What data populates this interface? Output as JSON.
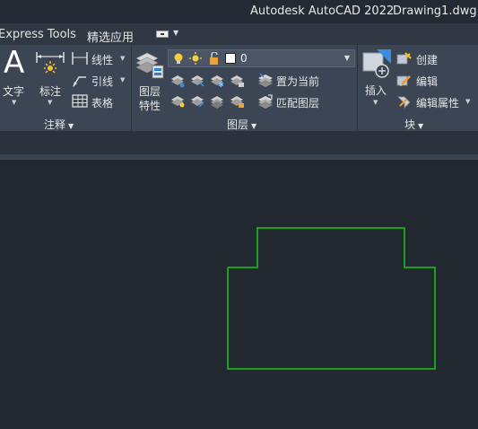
{
  "title": {
    "app": "Autodesk AutoCAD 2022",
    "document": "Drawing1.dwg"
  },
  "tabs": [
    {
      "label": "Express Tools"
    },
    {
      "label": "精选应用"
    }
  ],
  "annotation_panel": {
    "text_label": "文字",
    "dimension_label": "标注",
    "linear_label": "线性",
    "leader_label": "引线",
    "table_label": "表格",
    "panel_title": "注释"
  },
  "layers_panel": {
    "layer_properties_label_1": "图层",
    "layer_properties_label_2": "特性",
    "current_layer": "0",
    "set_current_label": "置为当前",
    "match_layer_label": "匹配图层",
    "panel_title": "图层"
  },
  "block_panel": {
    "insert_label": "插入",
    "create_label": "创建",
    "edit_label": "编辑",
    "edit_attributes_label": "编辑属性",
    "panel_title": "块"
  },
  "colors": {
    "drawing_line": "#19c819",
    "canvas_bg": "#212830",
    "ribbon_bg": "#3b4553"
  }
}
